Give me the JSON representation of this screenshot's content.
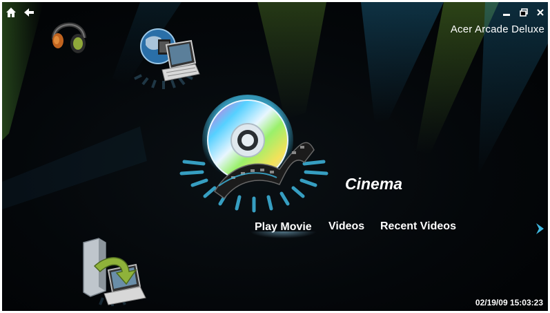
{
  "window": {
    "title": "Acer Arcade Deluxe",
    "controls": [
      "minimize",
      "restore",
      "close"
    ]
  },
  "nav": {
    "home_icon": "home-icon",
    "back_icon": "back-arrow-icon"
  },
  "hub_icons": [
    {
      "name": "music",
      "icon": "headphones-icon"
    },
    {
      "name": "online",
      "icon": "globe-laptop-icon"
    },
    {
      "name": "cinema",
      "icon": "disc-film-icon"
    },
    {
      "name": "backup",
      "icon": "pc-laptop-transfer-icon"
    }
  ],
  "section": {
    "title": "Cinema"
  },
  "menu": {
    "items": [
      "Play Movie",
      "Videos",
      "Recent Videos"
    ],
    "selected": "Play Movie",
    "next_icon": "chevron-right-icon"
  },
  "status": {
    "datetime": "02/19/09 15:03:23"
  },
  "colors": {
    "accent": "#3fb8e0",
    "ray_green": "#7fd23a",
    "ray_blue": "#1f7fb0",
    "text": "#ffffff"
  }
}
